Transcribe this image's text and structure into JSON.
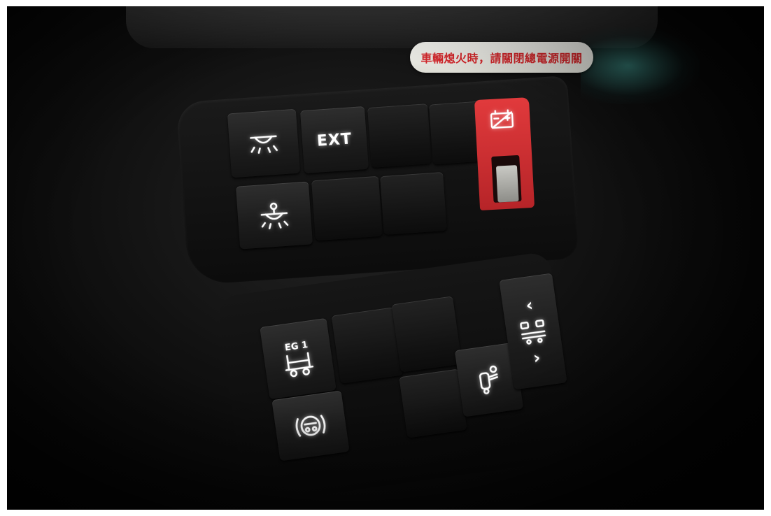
{
  "sticker": {
    "text": "車輛熄火時，請關閉總電源開關"
  },
  "switches": {
    "ext_label": "EXT",
    "eg1_label": "EG 1"
  },
  "colors": {
    "guard_red": "#d32f32",
    "backlight": "#ffffff",
    "sticker_text": "#d3262a"
  },
  "icons": {
    "interior_light": "dome-light-icon",
    "reading_light": "reading-light-icon",
    "battery_cutoff": "battery-cutoff-icon",
    "eg1": "lift-gear-icon",
    "brake": "brake-icon",
    "operator": "operator-icon",
    "selector": "axle-selector-icon",
    "arrow_left": "chevron-left-icon",
    "arrow_right": "chevron-right-icon"
  }
}
